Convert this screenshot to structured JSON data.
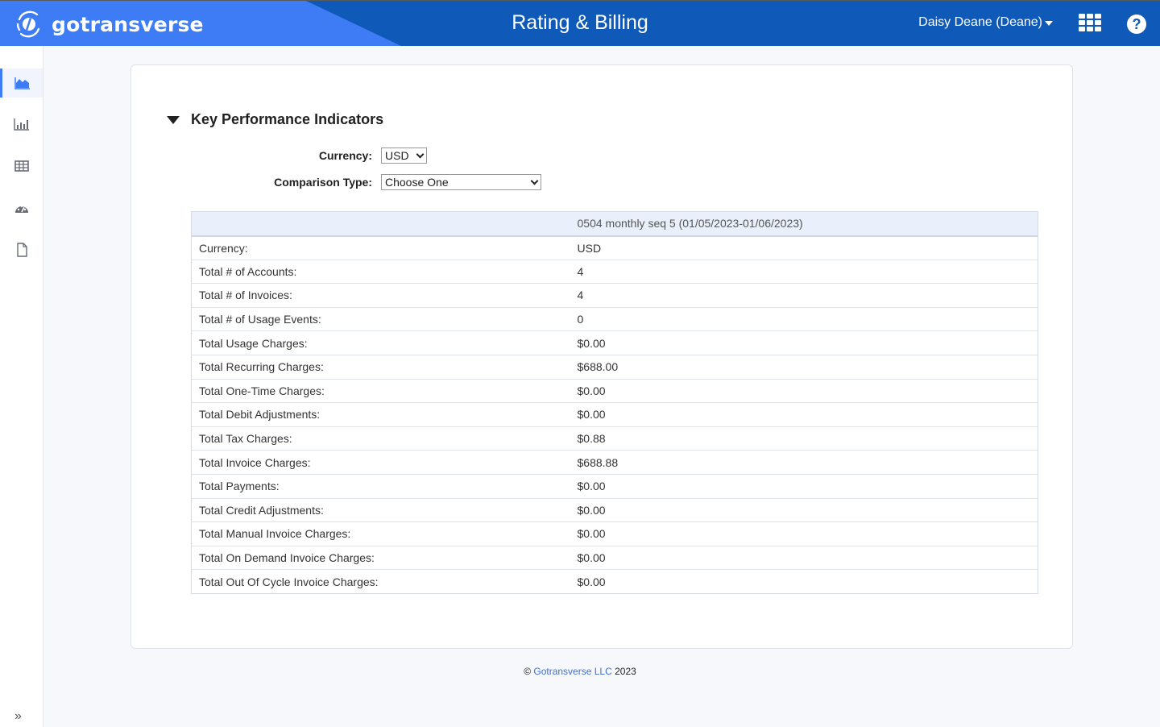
{
  "header": {
    "logo_text": "gotransverse",
    "app_title": "Rating & Billing",
    "user_name": "Daisy Deane (Deane)",
    "icons": [
      "apps-grid-icon",
      "help-icon"
    ]
  },
  "sidebar": {
    "items": [
      {
        "icon": "area-chart-icon",
        "active": true
      },
      {
        "icon": "bar-chart-icon",
        "active": false
      },
      {
        "icon": "table-icon",
        "active": false
      },
      {
        "icon": "dashboard-gauge-icon",
        "active": false
      },
      {
        "icon": "document-icon",
        "active": false
      }
    ],
    "expand_icon": "double-chevron-right-icon",
    "expand_glyph": "»"
  },
  "kpi": {
    "title": "Key Performance Indicators",
    "currency_label": "Currency:",
    "currency_value": "USD",
    "comparison_label": "Comparison Type:",
    "comparison_value": "Choose One",
    "table": {
      "column_header": "0504 monthly seq 5 (01/05/2023-01/06/2023)",
      "rows": [
        {
          "label": "Currency:",
          "value": "USD"
        },
        {
          "label": "Total # of Accounts:",
          "value": "4"
        },
        {
          "label": "Total # of Invoices:",
          "value": "4"
        },
        {
          "label": "Total # of Usage Events:",
          "value": "0"
        },
        {
          "label": "Total Usage Charges:",
          "value": "$0.00"
        },
        {
          "label": "Total Recurring Charges:",
          "value": "$688.00"
        },
        {
          "label": "Total One-Time Charges:",
          "value": "$0.00"
        },
        {
          "label": "Total Debit Adjustments:",
          "value": "$0.00"
        },
        {
          "label": "Total Tax Charges:",
          "value": "$0.88"
        },
        {
          "label": "Total Invoice Charges:",
          "value": "$688.88"
        },
        {
          "label": "Total Payments:",
          "value": "$0.00"
        },
        {
          "label": "Total Credit Adjustments:",
          "value": "$0.00"
        },
        {
          "label": "Total Manual Invoice Charges:",
          "value": "$0.00"
        },
        {
          "label": "Total On Demand Invoice Charges:",
          "value": "$0.00"
        },
        {
          "label": "Total Out Of Cycle Invoice Charges:",
          "value": "$0.00"
        }
      ]
    }
  },
  "footer": {
    "copyright": "©",
    "company_link": "Gotransverse LLC",
    "year": "2023"
  },
  "colors": {
    "header_dark": "#0f59b8",
    "header_brand": "#3d7cf5",
    "link": "#3d6fd9"
  }
}
